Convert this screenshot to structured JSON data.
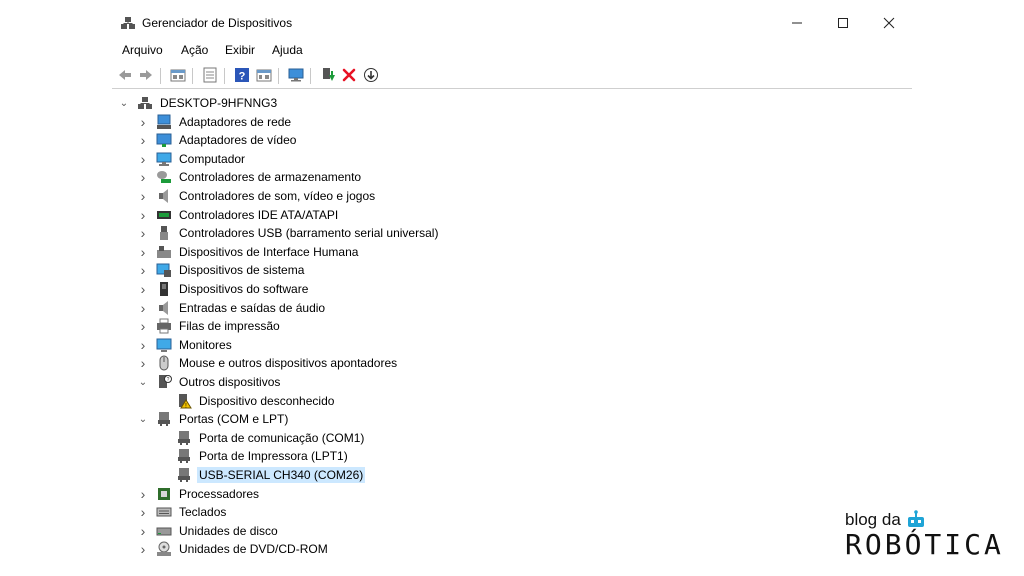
{
  "window": {
    "title": "Gerenciador de Dispositivos"
  },
  "menu": [
    "Arquivo",
    "Ação",
    "Exibir",
    "Ajuda"
  ],
  "toolbar_icons": [
    "back-icon",
    "forward-icon",
    "properties-icon",
    "update-driver-icon",
    "help-icon",
    "view-icon",
    "scan-hardware-icon",
    "add-driver-icon",
    "uninstall-icon",
    "download-icon"
  ],
  "tree": {
    "root": "DESKTOP-9HFNNG3",
    "items": [
      {
        "label": "Adaptadores de rede",
        "icon": "network-adapter-icon",
        "expanded": false
      },
      {
        "label": "Adaptadores de vídeo",
        "icon": "display-adapter-icon",
        "expanded": false
      },
      {
        "label": "Computador",
        "icon": "computer-icon",
        "expanded": false
      },
      {
        "label": "Controladores de armazenamento",
        "icon": "storage-controller-icon",
        "expanded": false
      },
      {
        "label": "Controladores de som, vídeo e jogos",
        "icon": "sound-icon",
        "expanded": false
      },
      {
        "label": "Controladores IDE ATA/ATAPI",
        "icon": "ide-controller-icon",
        "expanded": false
      },
      {
        "label": "Controladores USB (barramento serial universal)",
        "icon": "usb-icon",
        "expanded": false
      },
      {
        "label": "Dispositivos de Interface Humana",
        "icon": "hid-icon",
        "expanded": false
      },
      {
        "label": "Dispositivos de sistema",
        "icon": "system-device-icon",
        "expanded": false
      },
      {
        "label": "Dispositivos do software",
        "icon": "software-device-icon",
        "expanded": false
      },
      {
        "label": "Entradas e saídas de áudio",
        "icon": "audio-icon",
        "expanded": false
      },
      {
        "label": "Filas de impressão",
        "icon": "printer-icon",
        "expanded": false
      },
      {
        "label": "Monitores",
        "icon": "monitor-icon",
        "expanded": false
      },
      {
        "label": "Mouse e outros dispositivos apontadores",
        "icon": "mouse-icon",
        "expanded": false
      },
      {
        "label": "Outros dispositivos",
        "icon": "other-devices-icon",
        "expanded": true,
        "children": [
          {
            "label": "Dispositivo desconhecido",
            "icon": "unknown-device-warning-icon"
          }
        ]
      },
      {
        "label": "Portas (COM e LPT)",
        "icon": "port-icon",
        "expanded": true,
        "children": [
          {
            "label": "Porta de comunicação (COM1)",
            "icon": "port-icon"
          },
          {
            "label": "Porta de Impressora (LPT1)",
            "icon": "port-icon"
          },
          {
            "label": "USB-SERIAL CH340 (COM26)",
            "icon": "port-icon",
            "selected": true
          }
        ]
      },
      {
        "label": "Processadores",
        "icon": "processor-icon",
        "expanded": false
      },
      {
        "label": "Teclados",
        "icon": "keyboard-icon",
        "expanded": false
      },
      {
        "label": "Unidades de disco",
        "icon": "disk-drive-icon",
        "expanded": false
      },
      {
        "label": "Unidades de DVD/CD-ROM",
        "icon": "dvd-drive-icon",
        "expanded": false
      }
    ]
  },
  "watermark": {
    "line1": "blog da",
    "line2": "ROBÓTICA"
  },
  "colors": {
    "selection": "#cce8ff",
    "accent": "#0078d7",
    "uninstall": "#e81123"
  }
}
